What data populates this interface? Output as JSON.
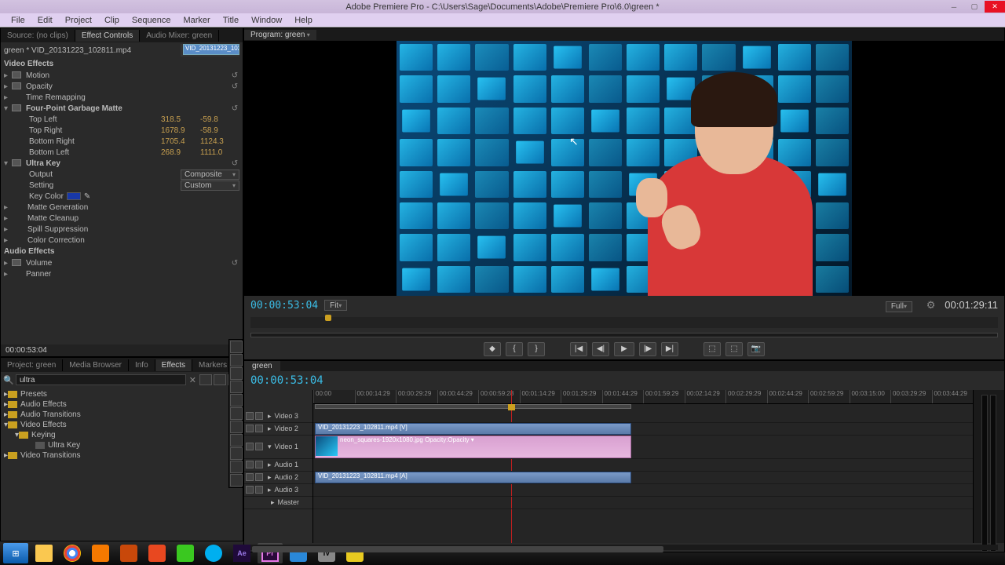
{
  "title": "Adobe Premiere Pro - C:\\Users\\Sage\\Documents\\Adobe\\Premiere Pro\\6.0\\green *",
  "menu": [
    "File",
    "Edit",
    "Project",
    "Clip",
    "Sequence",
    "Marker",
    "Title",
    "Window",
    "Help"
  ],
  "sourceTabs": {
    "source": "Source: (no clips)",
    "effectControls": "Effect Controls",
    "audioMixer": "Audio Mixer: green"
  },
  "ec": {
    "clipName": "green * VID_20131223_102811.mp4",
    "clipBlock": "VID_20131223_1028",
    "videoEffects": "Video Effects",
    "audioEffects": "Audio Effects",
    "motion": "Motion",
    "opacity": "Opacity",
    "timeRemap": "Time Remapping",
    "matte": {
      "name": "Four-Point Garbage Matte",
      "tl": {
        "label": "Top Left",
        "x": "318.5",
        "y": "-59.8"
      },
      "tr": {
        "label": "Top Right",
        "x": "1678.9",
        "y": "-58.9"
      },
      "br": {
        "label": "Bottom Right",
        "x": "1705.4",
        "y": "1124.3"
      },
      "bl": {
        "label": "Bottom Left",
        "x": "268.9",
        "y": "1111.0"
      }
    },
    "ultra": {
      "name": "Ultra Key",
      "output": {
        "label": "Output",
        "value": "Composite"
      },
      "setting": {
        "label": "Setting",
        "value": "Custom"
      },
      "keyColor": "Key Color",
      "matteGen": "Matte Generation",
      "matteClean": "Matte Cleanup",
      "spill": "Spill Suppression",
      "colorCorr": "Color Correction"
    },
    "volume": "Volume",
    "panner": "Panner",
    "timecode": "00:00:53:04"
  },
  "projectTabs": {
    "project": "Project: green",
    "mediaBrowser": "Media Browser",
    "info": "Info",
    "effects": "Effects",
    "markers": "Markers"
  },
  "search": {
    "placeholder": "",
    "value": "ultra"
  },
  "tree": {
    "presets": "Presets",
    "audioEffects": "Audio Effects",
    "audioTransitions": "Audio Transitions",
    "videoEffects": "Video Effects",
    "keying": "Keying",
    "ultraKey": "Ultra Key",
    "videoTransitions": "Video Transitions"
  },
  "program": {
    "label": "Program: green",
    "tcLeft": "00:00:53:04",
    "fit": "Fit",
    "full": "Full",
    "tcRight": "00:01:29:11"
  },
  "timeline": {
    "seqName": "green",
    "tc": "00:00:53:04",
    "ruler": [
      "00:00",
      "00:00:14:29",
      "00:00:29:29",
      "00:00:44:29",
      "00:00:59:28",
      "00:01:14:29",
      "00:01:29:29",
      "00:01:44:29",
      "00:01:59:29",
      "00:02:14:29",
      "00:02:29:29",
      "00:02:44:29",
      "00:02:59:29",
      "00:03:15:00",
      "00:03:29:29",
      "00:03:44:29"
    ],
    "tracks": {
      "v3": "Video 3",
      "v2": "Video 2",
      "v1": "Video 1",
      "a1": "Audio 1",
      "a2": "Audio 2",
      "a3": "Audio 3",
      "master": "Master"
    },
    "clips": {
      "v2": "VID_20131223_102811.mp4 [V]",
      "v1": "neon_squares-1920x1080.jpg  Opacity:Opacity ▾",
      "a2": "VID_20131223_102811.mp4 [A]"
    }
  }
}
